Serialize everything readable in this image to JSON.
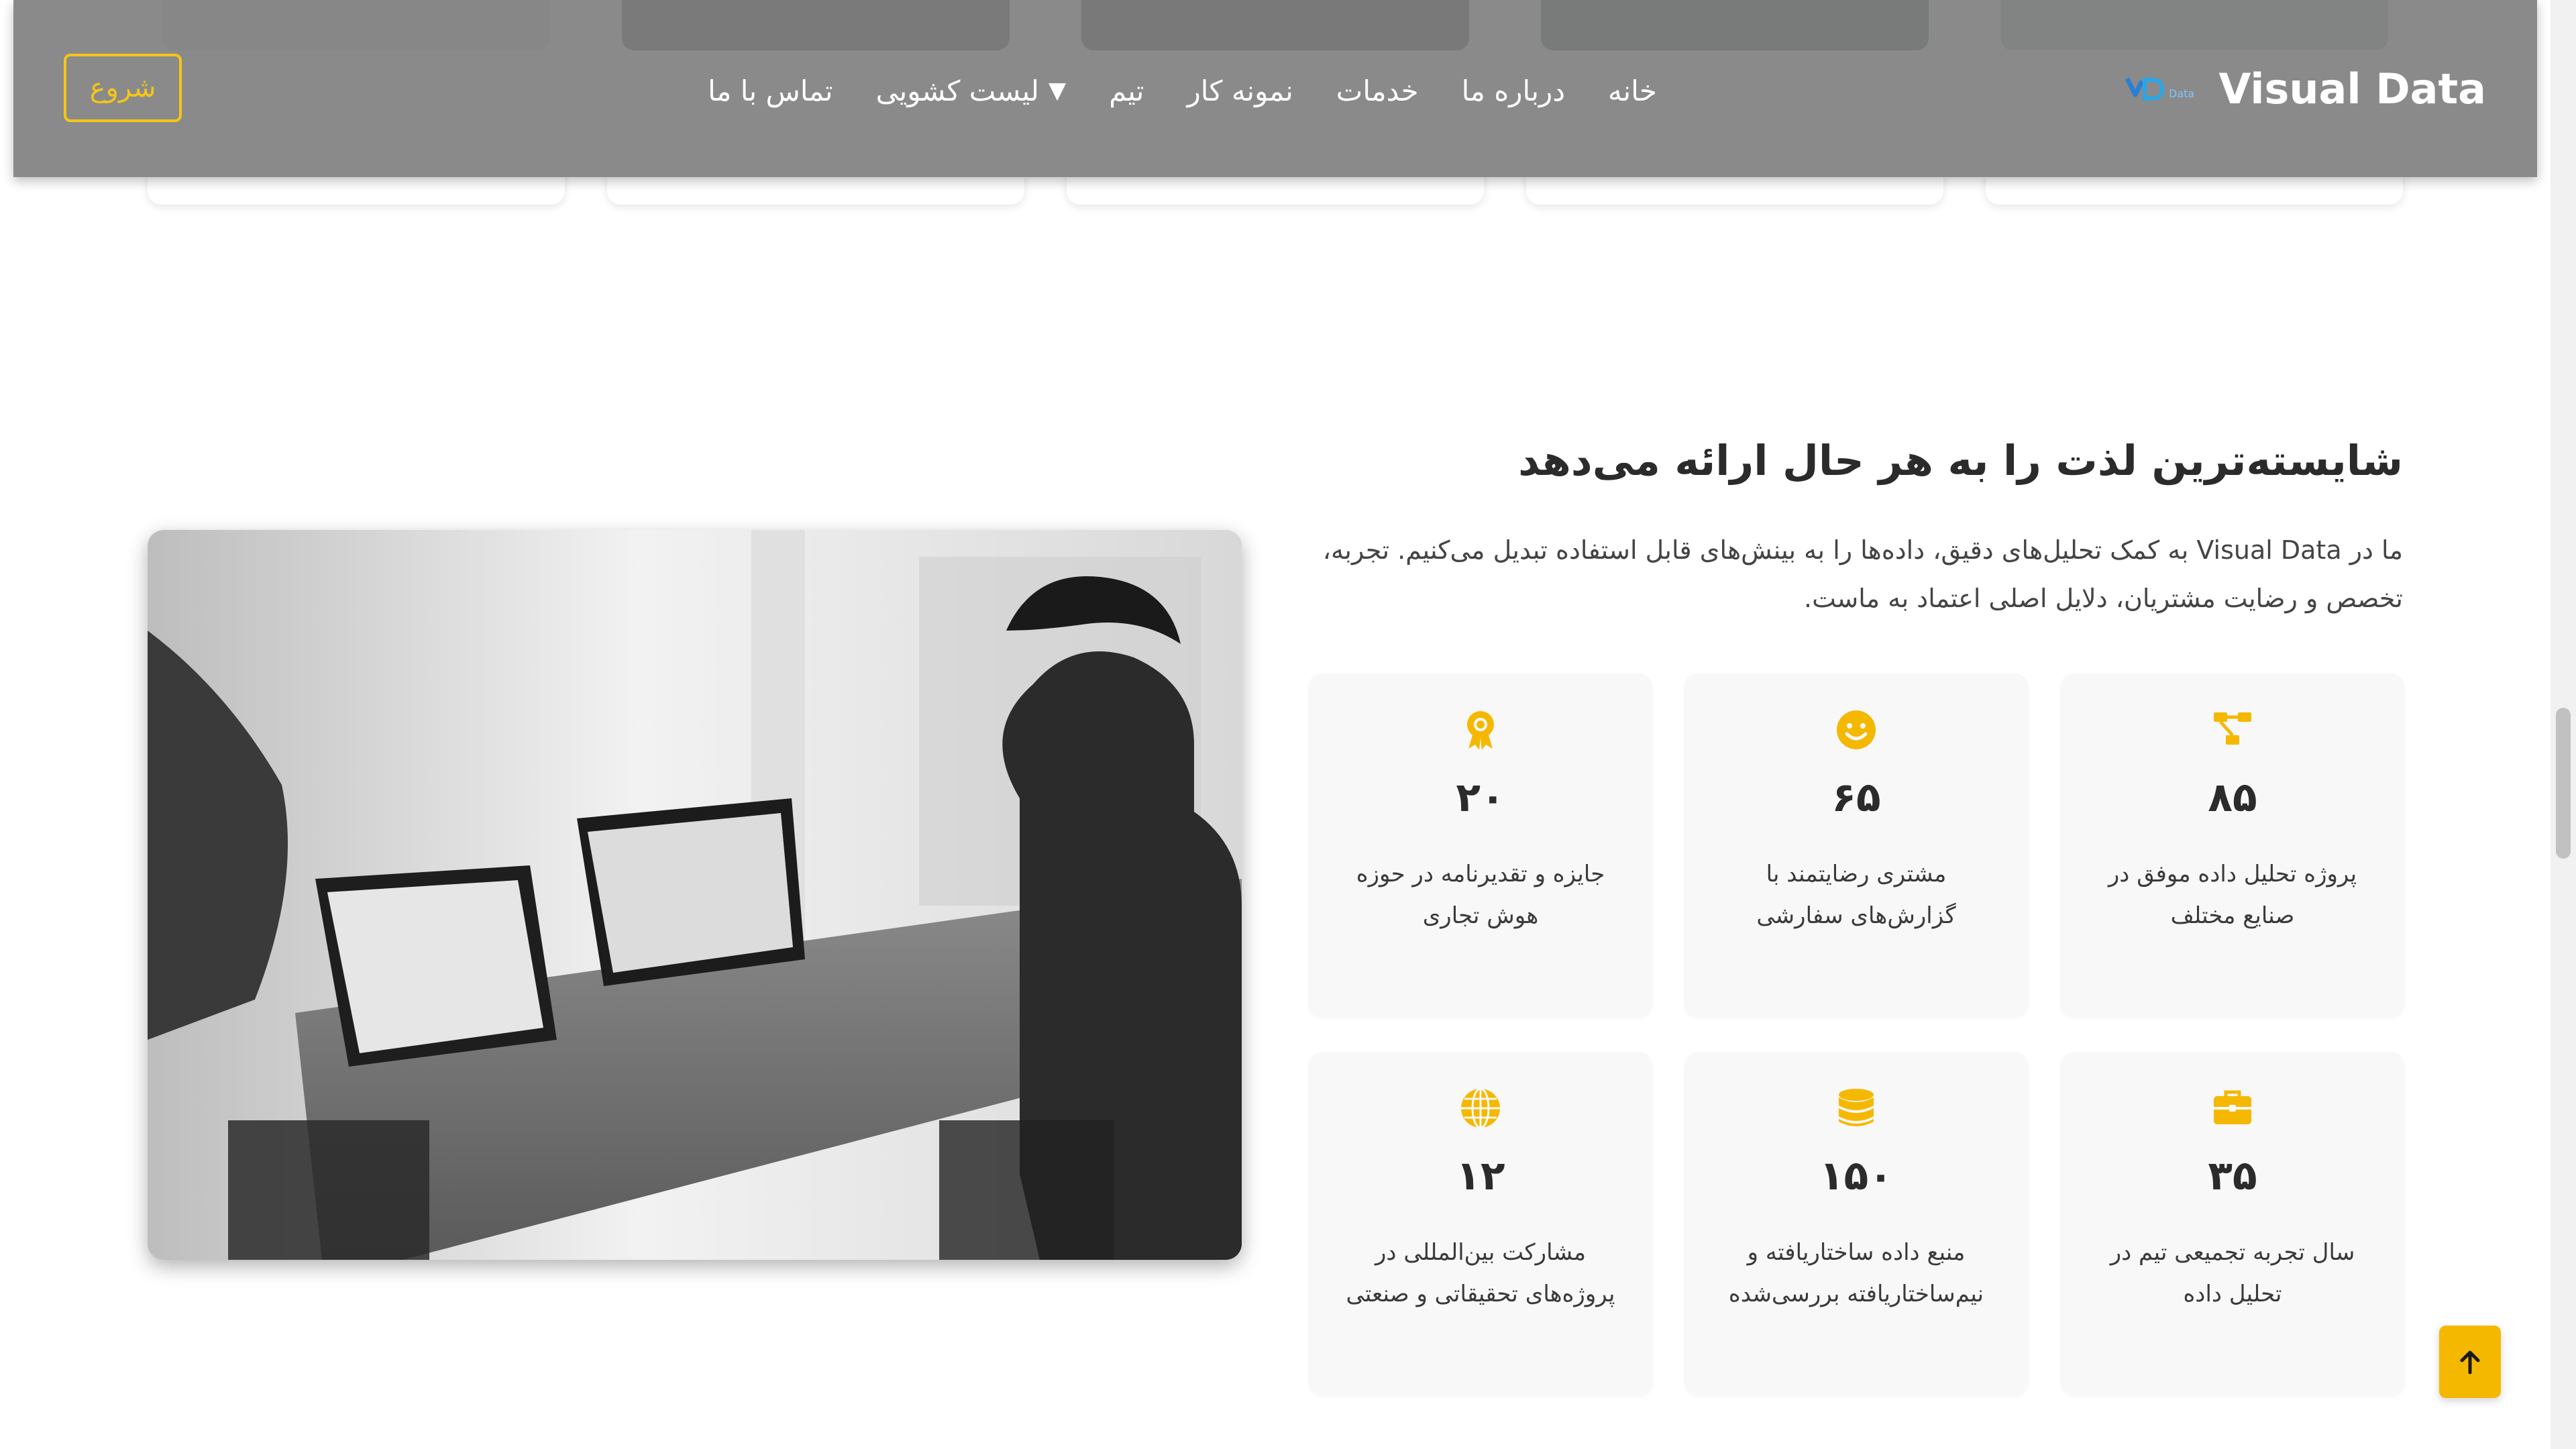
{
  "header": {
    "brand_name": "Visual Data",
    "logo_text": "Data",
    "start_button": "شروع",
    "nav": [
      {
        "label": "خانه"
      },
      {
        "label": "درباره ما"
      },
      {
        "label": "خدمات"
      },
      {
        "label": "نمونه کار"
      },
      {
        "label": "تیم"
      },
      {
        "label": "لیست کشویی",
        "caret": "▼"
      },
      {
        "label": "تماس با ما"
      }
    ]
  },
  "section": {
    "title": "شایسته‌ترین لذت را به هر حال ارائه می‌دهد",
    "description": "ما در Visual Data به کمک تحلیل‌های دقیق، داده‌ها را به بینش‌های قابل استفاده تبدیل می‌کنیم. تجربه، تخصص و رضایت مشتریان، دلایل اصلی اعتماد به ماست."
  },
  "stats": [
    {
      "icon": "diagram-icon",
      "number": "۸۵",
      "label": "پروژه تحلیل داده موفق در صنایع مختلف"
    },
    {
      "icon": "smile-icon",
      "number": "۶۵",
      "label": "مشتری رضایتمند با گزارش‌های سفارشی"
    },
    {
      "icon": "award-icon",
      "number": "۲۰",
      "label": "جایزه و تقدیرنامه در حوزه هوش تجاری"
    },
    {
      "icon": "briefcase-icon",
      "number": "۳۵",
      "label": "سال تجربه تجمیعی تیم در تحلیل داده"
    },
    {
      "icon": "database-icon",
      "number": "۱۵۰",
      "label": "منبع داده ساختاریافته و نیم‌ساختاریافته بررسی‌شده"
    },
    {
      "icon": "globe-icon",
      "number": "۱۲",
      "label": "مشارکت بین‌المللی در پروژه‌های تحقیقاتی و صنعتی"
    }
  ],
  "colors": {
    "accent": "#f5b800",
    "header_bg": "#808080",
    "card_bg": "#f8f8f8"
  }
}
